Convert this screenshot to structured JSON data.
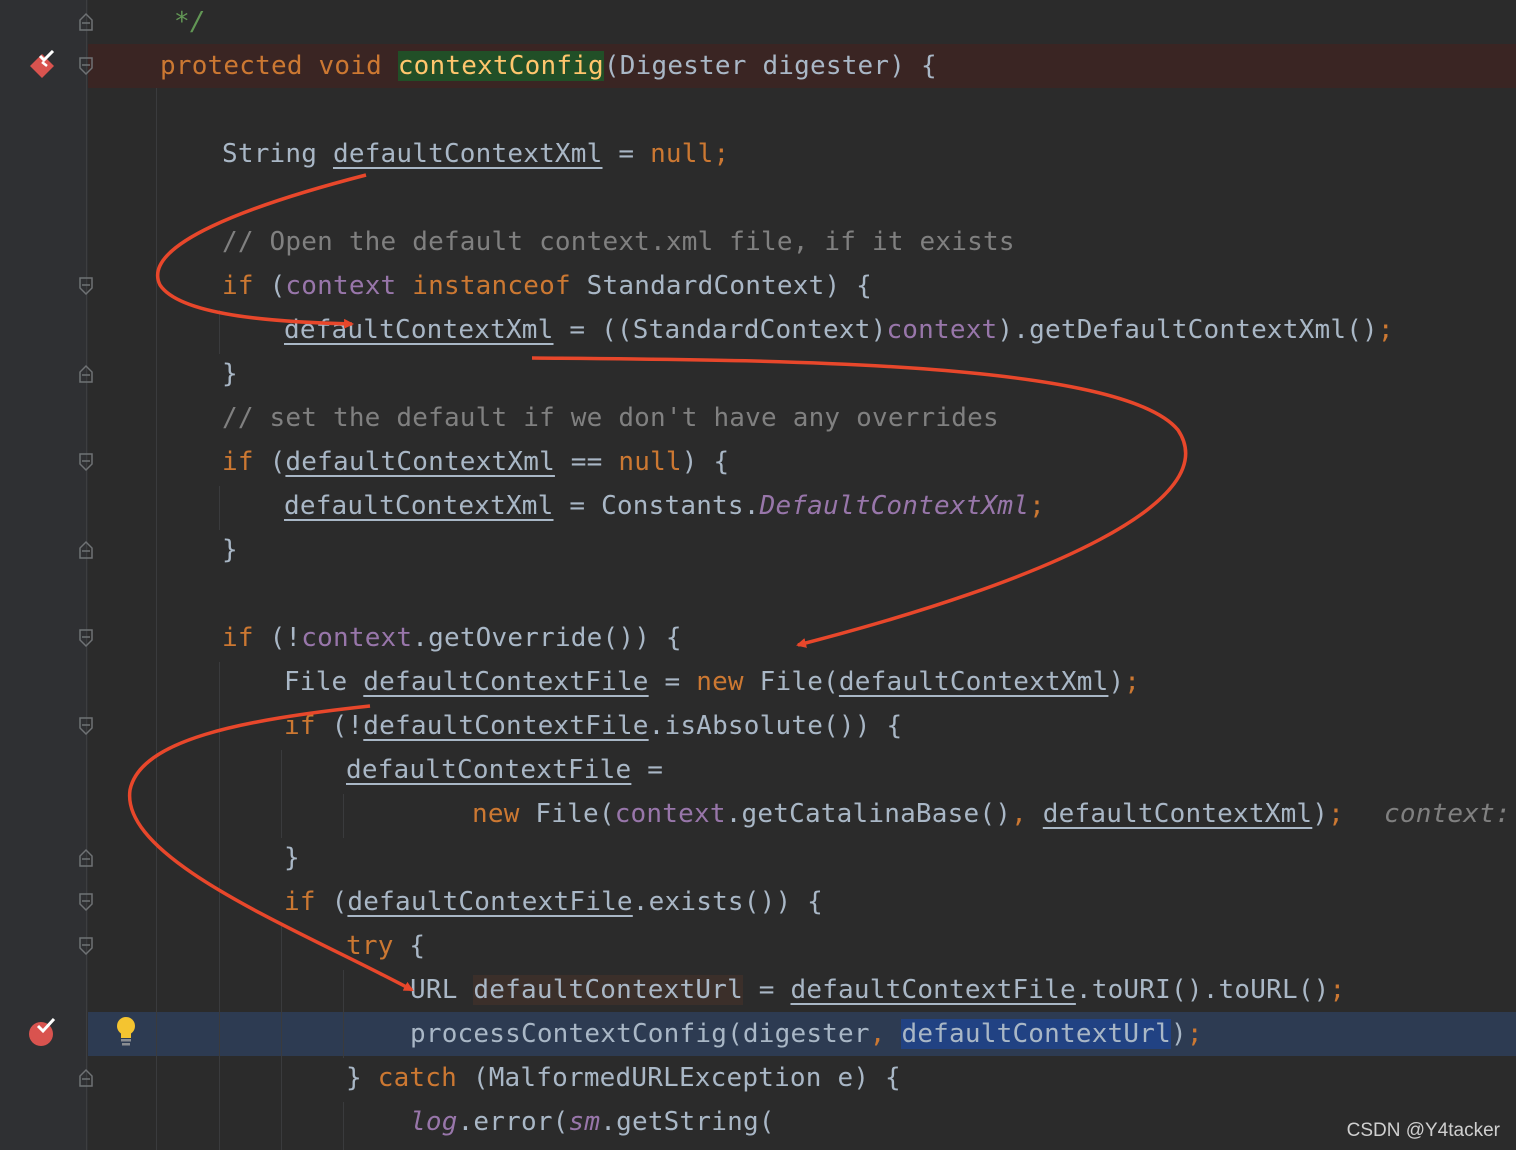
{
  "editor": {
    "code": {
      "l1": "*/",
      "l2_kw": "protected void ",
      "l2_method": "contextConfig",
      "l2_rest": "(Digester digester) {",
      "l4_type": "String ",
      "l4_var": "defaultContextXml",
      "l4_eq": " = ",
      "l4_null": "null",
      "l4_semi": ";",
      "l6": "// Open the default context.xml file, if it exists",
      "l7_if": "if ",
      "l7_paren": "(",
      "l7_ctx": "context",
      "l7_sp": " ",
      "l7_inst": "instanceof",
      "l7_rest": " StandardContext) {",
      "l8_var": "defaultContextXml",
      "l8_mid": " = ((StandardContext)",
      "l8_ctx": "context",
      "l8_rest": ").getDefaultContextXml()",
      "l8_semi": ";",
      "l9": "}",
      "l10": "// set the default if we don't have any overrides",
      "l11_if": "if ",
      "l11_paren": "(",
      "l11_var": "defaultContextXml",
      "l11_eq": " == ",
      "l11_null": "null",
      "l11_rest": ") {",
      "l12_var": "defaultContextXml",
      "l12_mid": " = Constants.",
      "l12_const": "DefaultContextXml",
      "l12_semi": ";",
      "l13": "}",
      "l15_if": "if ",
      "l15_paren": "(!",
      "l15_ctx": "context",
      "l15_rest": ".getOverride()) {",
      "l16_type": "File ",
      "l16_var": "defaultContextFile",
      "l16_eq": " = ",
      "l16_new": "new ",
      "l16_ctor": "File(",
      "l16_arg": "defaultContextXml",
      "l16_close": ")",
      "l16_semi": ";",
      "l17_if": "if ",
      "l17_paren": "(!",
      "l17_var": "defaultContextFile",
      "l17_rest": ".isAbsolute()) {",
      "l18_var": "defaultContextFile",
      "l18_eq": " =",
      "l19_new": "new ",
      "l19_ctor": "File(",
      "l19_ctx": "context",
      "l19_call": ".getCatalinaBase()",
      "l19_comma": ", ",
      "l19_var": "defaultContextXml",
      "l19_close": ")",
      "l19_semi": ";",
      "l19_hint": "context: ",
      "l20": "}",
      "l21_if": "if ",
      "l21_paren": "(",
      "l21_var": "defaultContextFile",
      "l21_rest": ".exists()) {",
      "l22_try": "try",
      "l22_rest": " {",
      "l23_type": "URL ",
      "l23_var": "defaultContextUrl",
      "l23_eq": " = ",
      "l23_file": "defaultContextFile",
      "l23_rest": ".toURI().toURL()",
      "l23_semi": ";",
      "l24_call": "processContextConfig(digester",
      "l24_comma": ", ",
      "l24_var": "defaultContextUrl",
      "l24_close": ")",
      "l24_semi": ";",
      "l25_brace": "} ",
      "l25_catch": "catch",
      "l25_rest": " (MalformedURLException e) {",
      "l26_log": "log",
      "l26_dot": ".error(",
      "l26_sm": "sm",
      "l26_rest": ".getString("
    }
  },
  "watermark": "CSDN @Y4tacker",
  "colors": {
    "background": "#2b2b2b",
    "keyword": "#cc7832",
    "comment": "#808080",
    "field": "#9876aa",
    "method_highlight": "#ffc66d",
    "annotation_arrow": "#e8472b",
    "breakpoint": "#d9534f"
  }
}
